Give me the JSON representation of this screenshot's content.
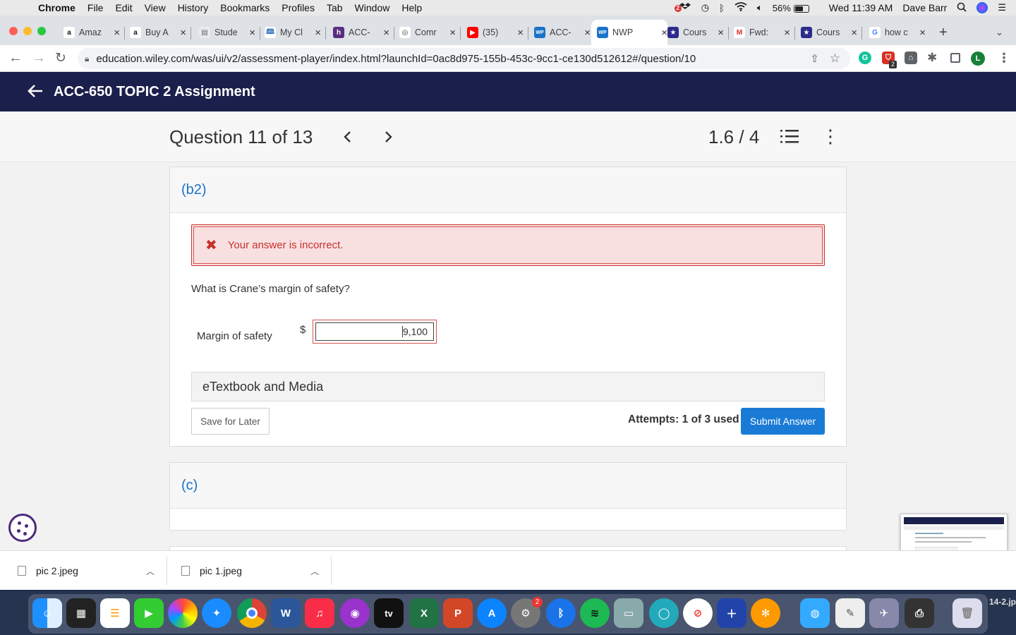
{
  "menubar": {
    "app": "Chrome",
    "items": [
      "File",
      "Edit",
      "View",
      "History",
      "Bookmarks",
      "Profiles",
      "Tab",
      "Window",
      "Help"
    ],
    "battery": "56%",
    "clock": "Wed 11:39 AM",
    "user": "Dave Barr",
    "dropbox_badge": "2"
  },
  "tabs": [
    {
      "title": "Amaz",
      "favicon_letter": "a",
      "favicon_color": "#ffffff",
      "favicon_text_color": "#111111"
    },
    {
      "title": "Buy A",
      "favicon_letter": "a",
      "favicon_color": "#ffffff",
      "favicon_text_color": "#111111"
    },
    {
      "title": "Stude",
      "favicon_letter": "▤",
      "favicon_color": "#e8eaed",
      "favicon_text_color": "#5f6368"
    },
    {
      "title": "My Cl",
      "favicon_letter": "🕮",
      "favicon_color": "#ffffff",
      "favicon_text_color": "#2b6fb6"
    },
    {
      "title": "ACC-",
      "favicon_letter": "h",
      "favicon_color": "#5a2d82",
      "favicon_text_color": "#ffffff"
    },
    {
      "title": "Comr",
      "favicon_letter": "◎",
      "favicon_color": "#ffffff",
      "favicon_text_color": "#444444"
    },
    {
      "title": "(35)",
      "favicon_letter": "▶",
      "favicon_color": "#ff0000",
      "favicon_text_color": "#ffffff"
    },
    {
      "title": "ACC-",
      "favicon_letter": "WP",
      "favicon_color": "#1a73c8",
      "favicon_text_color": "#ffffff"
    },
    {
      "title": "NWP",
      "favicon_letter": "WP",
      "favicon_color": "#1a73c8",
      "favicon_text_color": "#ffffff",
      "active": true
    },
    {
      "title": "Cours",
      "favicon_letter": "★",
      "favicon_color": "#2b2b8c",
      "favicon_text_color": "#ffffff"
    },
    {
      "title": "Fwd:",
      "favicon_letter": "M",
      "favicon_color": "#ffffff",
      "favicon_text_color": "#d93025"
    },
    {
      "title": "Cours",
      "favicon_letter": "★",
      "favicon_color": "#2b2b8c",
      "favicon_text_color": "#ffffff"
    },
    {
      "title": "how c",
      "favicon_letter": "G",
      "favicon_color": "#ffffff",
      "favicon_text_color": "#4285f4"
    }
  ],
  "toolbar": {
    "url": "education.wiley.com/was/ui/v2/assessment-player/index.html?launchId=0ac8d975-155b-453c-9cc1-ce130d512612#/question/10",
    "ext_badge": "2",
    "profile_letter": "L"
  },
  "app": {
    "title": "ACC-650 TOPIC 2 Assignment"
  },
  "question_bar": {
    "title": "Question 11 of 13",
    "score": "1.6 / 4"
  },
  "part_b2": {
    "label": "(b2)",
    "feedback": "Your answer is incorrect.",
    "question": "What is Crane’s margin of safety?",
    "field_label": "Margin of safety",
    "currency": "$",
    "field_value": "9,100",
    "etextbook": "eTextbook and Media",
    "save_label": "Save for Later",
    "attempts": "Attempts: 1 of 3 used",
    "submit_label": "Submit Answer"
  },
  "part_c": {
    "label": "(c)"
  },
  "downloads": [
    {
      "name": "pic 2.jpeg"
    },
    {
      "name": "pic 1.jpeg"
    }
  ],
  "dock": {
    "calendar_badge": "2",
    "desktop_label": "14-2.jp"
  },
  "colors": {
    "header_bg": "#1b1f4b",
    "link_blue": "#1a73c8",
    "error_red": "#c9302c",
    "error_bg": "#f8e0e1",
    "submit_blue": "#1a7bd6"
  }
}
